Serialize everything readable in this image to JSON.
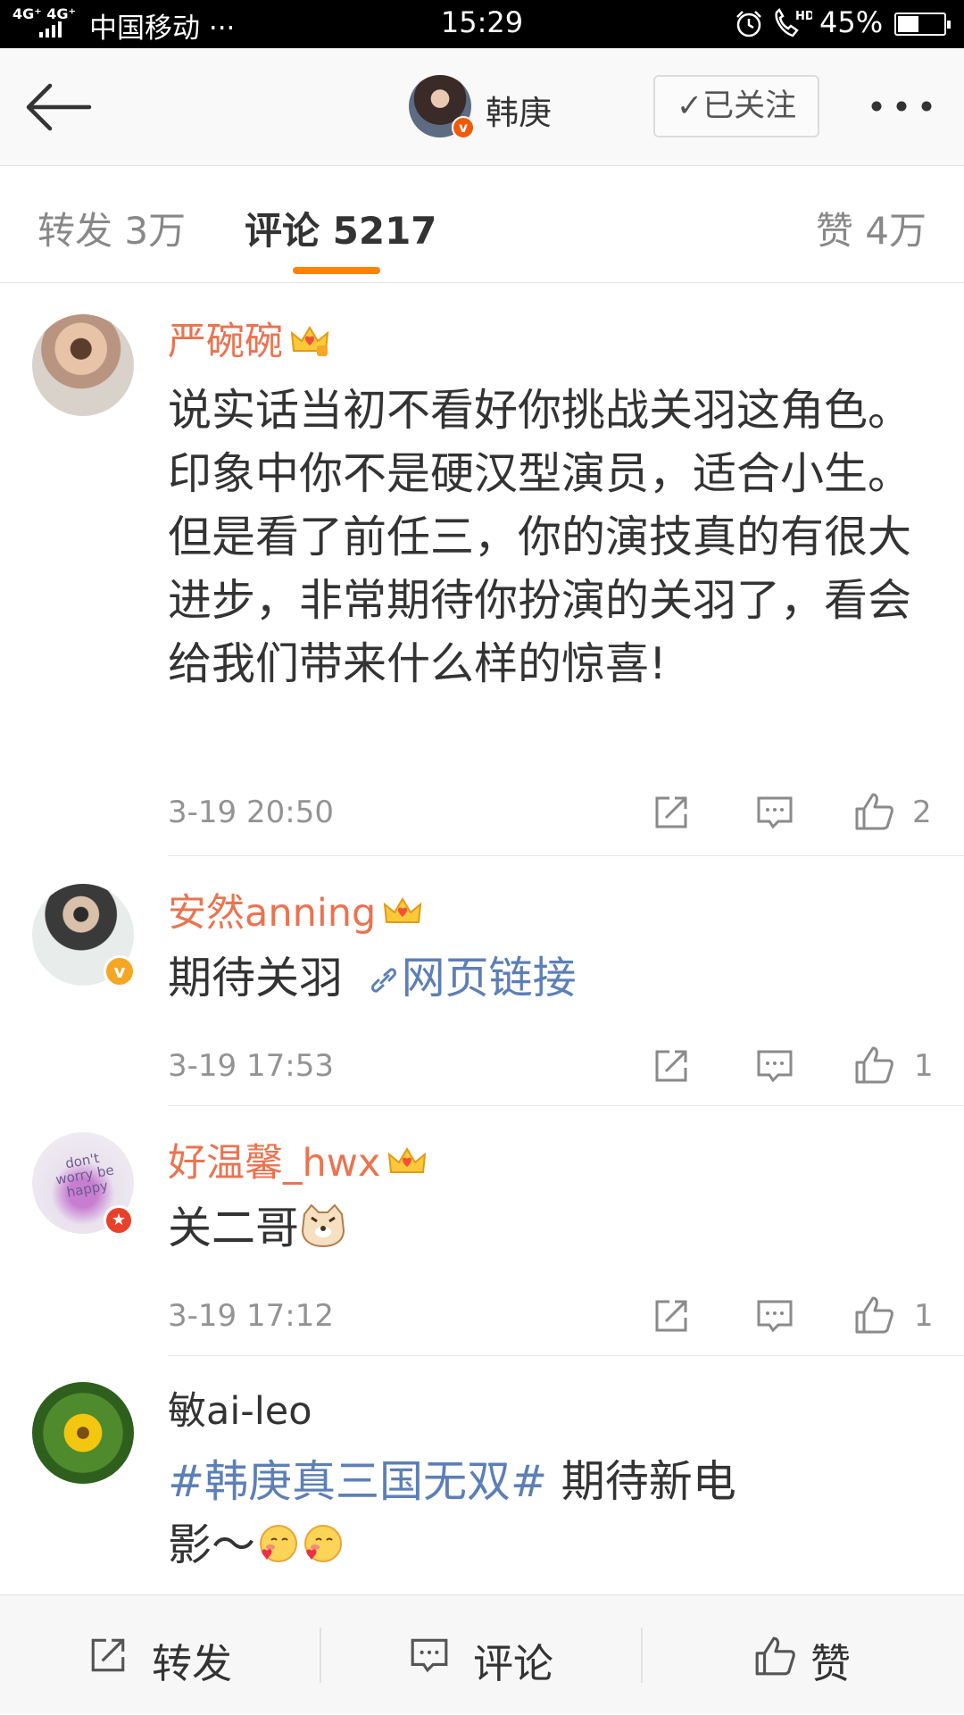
{
  "status_bar": {
    "signal": "4G⁺ 4G⁺",
    "carrier": "中国移动 ···",
    "time": "15:29",
    "battery": "45%",
    "battery_level": 0.45,
    "icons": [
      "signal-icon",
      "alarm-icon",
      "hd-call-icon",
      "battery-icon"
    ]
  },
  "nav": {
    "title": "韩庚",
    "follow_label": "✓已关注",
    "icons": [
      "back-arrow-icon",
      "more-dots-icon",
      "verified-icon"
    ]
  },
  "tabs": {
    "repost": "转发 3万",
    "comment": "评论 5217",
    "like": "赞 4万",
    "active": "comment",
    "accent": "#ff8200"
  },
  "colors": {
    "username": "#eb7350",
    "link": "#5d7fb6",
    "muted": "#939393"
  },
  "comments": [
    {
      "username": "严碗碗",
      "text": "说实话当初不看好你挑战关羽这角色。印象中你不是硬汉型演员，适合小生。但是看了前任三，你的演技真的有很大进步，非常期待你扮演的关羽了，看会给我们带来什么样的惊喜!",
      "time": "3-19 20:50",
      "likes": "2"
    },
    {
      "username": "安然anning",
      "text": "期待关羽",
      "link": "网页链接",
      "time": "3-19 17:53",
      "likes": "1"
    },
    {
      "username": "好温馨_hwx",
      "text": "关二哥",
      "time": "3-19 17:12",
      "likes": "1"
    },
    {
      "username": "敏ai-leo",
      "topic": "#韩庚真三国无双#",
      "text": " 期待新电",
      "text2": "影～",
      "avatar_text": "don't worry be happy"
    }
  ],
  "toolbar": {
    "repost": "转发",
    "comment": "评论",
    "like": "赞"
  }
}
